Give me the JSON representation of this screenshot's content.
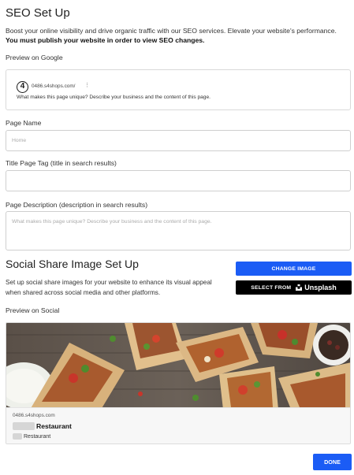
{
  "seo": {
    "title": "SEO Set Up",
    "intro": "Boost your online visibility and drive organic traffic with our SEO services. Elevate your website's performance.",
    "intro_bold": "You must publish your website in order to view SEO changes.",
    "preview_label": "Preview on Google",
    "google_preview": {
      "favicon": "4",
      "url": "0486.s4shops.com/",
      "kebab": "⋮",
      "description": "What makes this page unique? Describe your business and the content of this page."
    },
    "page_name_label": "Page Name",
    "page_name_placeholder": "Home",
    "page_name_value": "",
    "title_tag_label": "Title Page Tag (title in search results)",
    "title_tag_value": "",
    "page_description_label": "Page Description (description in search results)",
    "page_description_placeholder": "What makes this page unique? Describe your business and the content of this page."
  },
  "social": {
    "title": "Social Share Image Set Up",
    "description": "Set up social share images for your website to enhance its visual appeal when shared across social media and other platforms.",
    "change_image_label": "CHANGE IMAGE",
    "select_from_label": "SELECT FROM",
    "unsplash_label": "Unsplash",
    "preview_label": "Preview on Social",
    "card": {
      "url": "0486.s4shops.com",
      "title": "Restaurant",
      "subtitle": "Restaurant"
    }
  },
  "footer": {
    "done_label": "DONE"
  },
  "colors": {
    "accent": "#1b5cf5",
    "dark_button": "#000000",
    "border": "#cfcfcf"
  },
  "icons": {
    "google_favicon": "site-favicon-icon",
    "unsplash": "unsplash-logo-icon",
    "more": "more-vertical-icon"
  }
}
